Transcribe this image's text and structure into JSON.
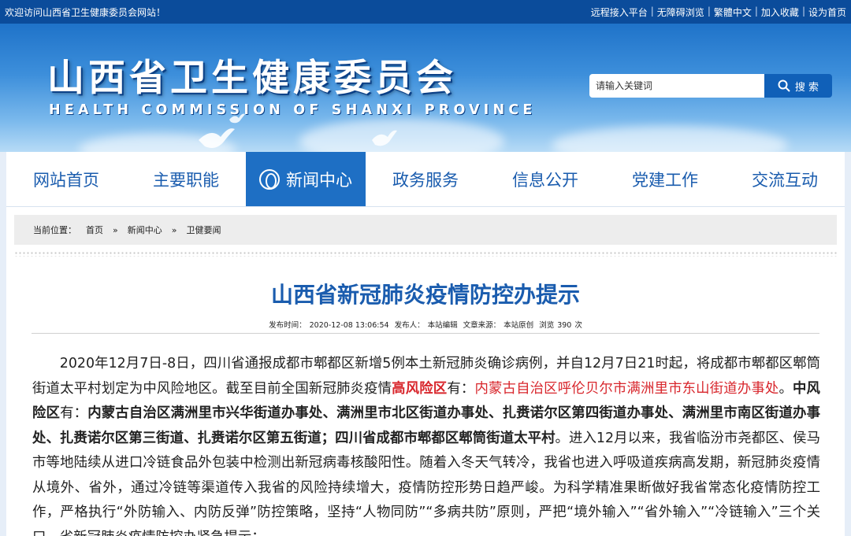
{
  "topbar": {
    "welcome": "欢迎访问山西省卫生健康委员会网站！",
    "links": [
      "远程接入平台",
      "无障碍浏览",
      "繁體中文",
      "加入收藏",
      "设为首页"
    ],
    "separator": "|"
  },
  "header": {
    "title": "山西省卫生健康委员会",
    "subtitle": "HEALTH COMMISSION OF SHANXI PROVINCE",
    "search": {
      "placeholder": "请输入关键词",
      "button_label": "搜 索"
    }
  },
  "nav": {
    "items": [
      "网站首页",
      "主要职能",
      "新闻中心",
      "政务服务",
      "信息公开",
      "党建工作",
      "交流互动"
    ],
    "active_index": 2
  },
  "breadcrumb": {
    "prefix": "当前位置：",
    "items": [
      "首页",
      "新闻中心",
      "卫健要闻"
    ],
    "separator": "»"
  },
  "article": {
    "title": "山西省新冠肺炎疫情防控办提示",
    "meta": {
      "time_label": "发布时间：",
      "time": "2020-12-08 13:06:54",
      "publisher_label": "发布人：",
      "publisher": "本站编辑",
      "source_label": "文章来源：",
      "source": "本站原创",
      "views_label": "浏览",
      "views": "390",
      "views_unit": "次"
    },
    "p1": "2020年12月7日-8日，四川省通报成都市郫都区新增5例本土新冠肺炎确诊病例，并自12月7日21时起，将成都市郫都区郫筒街道太平村划定为中风险地区。截至目前全国新冠肺炎疫情",
    "high_risk_label": "高风险区",
    "p2": "有：",
    "high_risk_areas": "内蒙古自治区呼伦贝尔市满洲里市东山街道办事处",
    "p3": "。",
    "mid_risk_label": "中风险区",
    "p4": "有：",
    "mid_risk_areas": "内蒙古自治区满洲里市兴华街道办事处、满洲里市北区街道办事处、扎赉诺尔区第四街道办事处、满洲里市南区街道办事处、扎赉诺尔区第三街道、扎赉诺尔区第五街道；四川省成都市郫都区郫筒街道太平村",
    "p5": "。进入12月以来，我省临汾市尧都区、侯马市等地陆续从进口冷链食品外包装中检测出新冠病毒核酸阳性。随着入冬天气转冷，我省也进入呼吸道疾病高发期，新冠肺炎疫情从境外、省外，通过冷链等渠道传入我省的风险持续增大，疫情防控形势日趋严峻。为科学精准果断做好我省常态化疫情防控工作，严格执行“外防输入、内防反弹”防控策略，坚持“人物同防”“多病共防”原则，严把“境外输入”“省外输入”“冷链输入”三个关口，省新冠肺炎疫情防控办紧急提示："
  },
  "colors": {
    "brand_blue": "#1a5cae",
    "topbar": "#0b4c9b",
    "nav_active": "#1e6fc4",
    "risk_red": "#d8262c"
  },
  "icons": {
    "search": "search-icon",
    "nav_active": "globe-icon"
  }
}
